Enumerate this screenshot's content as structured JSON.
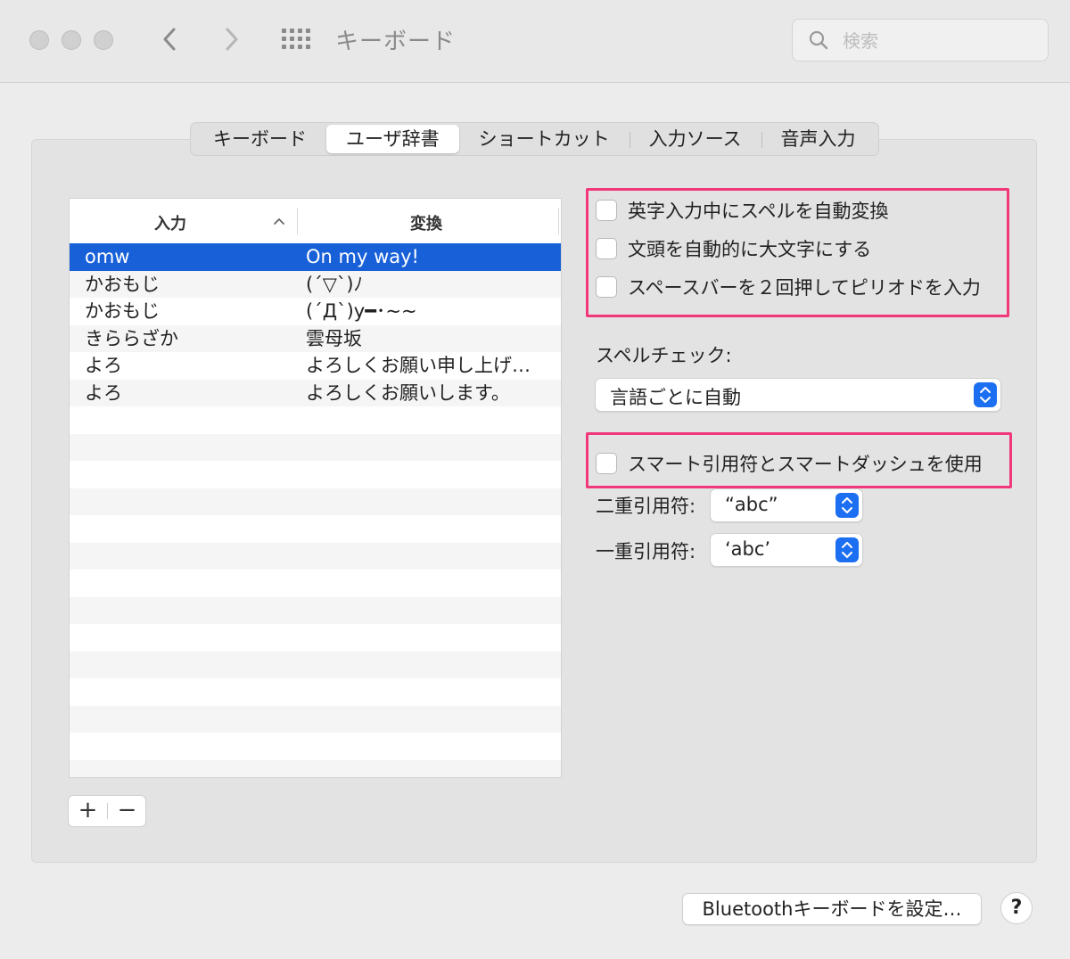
{
  "window": {
    "title": "キーボード",
    "search_placeholder": "検索"
  },
  "tabs": [
    {
      "label": "キーボード",
      "active": false
    },
    {
      "label": "ユーザ辞書",
      "active": true
    },
    {
      "label": "ショートカット",
      "active": false
    },
    {
      "label": "入力ソース",
      "active": false
    },
    {
      "label": "音声入力",
      "active": false
    }
  ],
  "dictionary": {
    "columns": [
      "入力",
      "変換"
    ],
    "rows": [
      {
        "input": "omw",
        "output": "On my way!",
        "selected": true
      },
      {
        "input": "かおもじ",
        "output": "(´▽`)ﾉ",
        "selected": false
      },
      {
        "input": "かおもじ",
        "output": "(´Д`)y━･~~",
        "selected": false
      },
      {
        "input": "きららざか",
        "output": "雲母坂",
        "selected": false
      },
      {
        "input": "よろ",
        "output": "よろしくお願い申し上げ…",
        "selected": false
      },
      {
        "input": "よろ",
        "output": "よろしくお願いします。",
        "selected": false
      }
    ],
    "add_label": "+",
    "remove_label": "−"
  },
  "options": {
    "auto_correct": "英字入力中にスペルを自動変換",
    "auto_capitalize": "文頭を自動的に大文字にする",
    "double_space_period": "スペースバーを２回押してピリオドを入力",
    "spellcheck_label": "スペルチェック:",
    "spellcheck_value": "言語ごとに自動",
    "smart_quotes": "スマート引用符とスマートダッシュを使用",
    "double_quote_label": "二重引用符:",
    "double_quote_value": "“abc”",
    "single_quote_label": "一重引用符:",
    "single_quote_value": "‘abc’"
  },
  "footer": {
    "bluetooth_button": "Bluetoothキーボードを設定…",
    "help_label": "?"
  },
  "colors": {
    "selection": "#1760d8",
    "highlight_box": "#f0387a",
    "stepper": "#1d6ff2"
  }
}
